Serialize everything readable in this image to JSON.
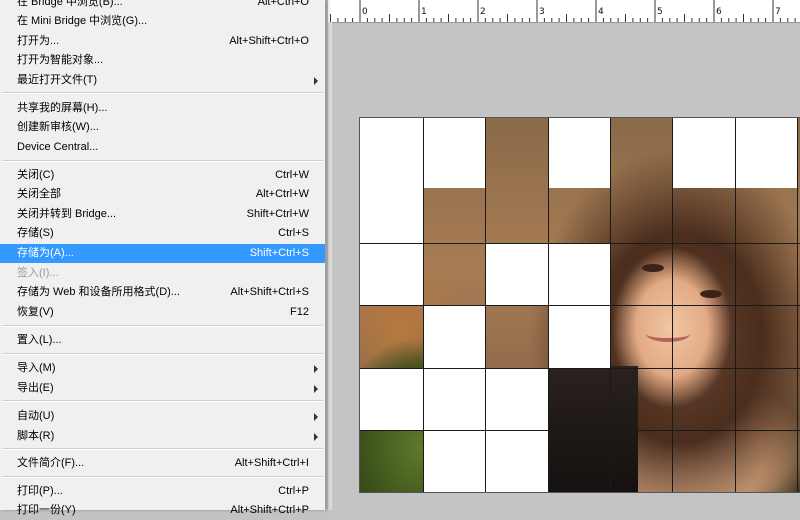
{
  "menu": {
    "items": [
      {
        "label": "在 Bridge 中浏览(B)...",
        "shortcut": "Alt+Ctrl+O"
      },
      {
        "label": "在 Mini Bridge 中浏览(G)...",
        "shortcut": ""
      },
      {
        "label": "打开为...",
        "shortcut": "Alt+Shift+Ctrl+O"
      },
      {
        "label": "打开为智能对象...",
        "shortcut": ""
      },
      {
        "label": "最近打开文件(T)",
        "shortcut": ""
      },
      {
        "label": "共享我的屏幕(H)...",
        "shortcut": ""
      },
      {
        "label": "创建新审核(W)...",
        "shortcut": ""
      },
      {
        "label": "Device Central...",
        "shortcut": ""
      },
      {
        "label": "关闭(C)",
        "shortcut": "Ctrl+W"
      },
      {
        "label": "关闭全部",
        "shortcut": "Alt+Ctrl+W"
      },
      {
        "label": "关闭并转到 Bridge...",
        "shortcut": "Shift+Ctrl+W"
      },
      {
        "label": "存储(S)",
        "shortcut": "Ctrl+S"
      },
      {
        "label": "存储为(A)...",
        "shortcut": "Shift+Ctrl+S"
      },
      {
        "label": "签入(I)...",
        "shortcut": ""
      },
      {
        "label": "存储为 Web 和设备所用格式(D)...",
        "shortcut": "Alt+Shift+Ctrl+S"
      },
      {
        "label": "恢复(V)",
        "shortcut": "F12"
      },
      {
        "label": "置入(L)...",
        "shortcut": ""
      },
      {
        "label": "导入(M)",
        "shortcut": ""
      },
      {
        "label": "导出(E)",
        "shortcut": ""
      },
      {
        "label": "自动(U)",
        "shortcut": ""
      },
      {
        "label": "脚本(R)",
        "shortcut": ""
      },
      {
        "label": "文件简介(F)...",
        "shortcut": "Alt+Shift+Ctrl+I"
      },
      {
        "label": "打印(P)...",
        "shortcut": "Ctrl+P"
      },
      {
        "label": "打印一份(Y)",
        "shortcut": "Alt+Shift+Ctrl+P"
      }
    ],
    "selected_label": "存储为(A)...",
    "disabled_label": "签入(I)..."
  },
  "ruler": {
    "ticks": [
      "0",
      "1",
      "2",
      "3",
      "4",
      "5",
      "6",
      "7"
    ]
  },
  "colors": {
    "highlight": "#3399ff",
    "menu_bg": "#f0f0f0",
    "workspace": "#c4c4c4"
  }
}
